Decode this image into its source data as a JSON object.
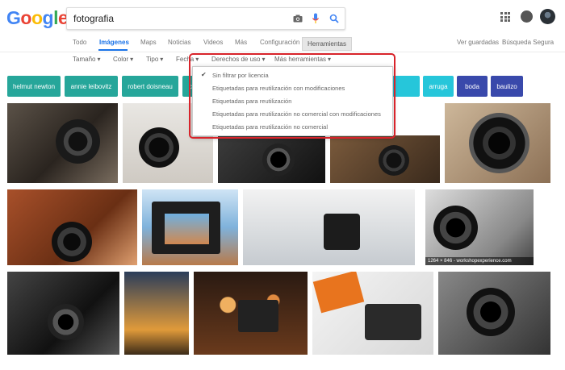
{
  "logo": {
    "letters": [
      "G",
      "o",
      "o",
      "g",
      "l",
      "e"
    ],
    "colors": [
      "#4285f4",
      "#ea4335",
      "#fbbc05",
      "#4285f4",
      "#34a853",
      "#ea4335"
    ]
  },
  "search": {
    "query": "fotografia"
  },
  "nav": {
    "tabs": [
      "Todo",
      "Imágenes",
      "Maps",
      "Noticias",
      "Videos",
      "Más",
      "Configuración",
      "Herramientas"
    ],
    "active": "Imágenes",
    "saved": "Ver guardadas",
    "safe_search": "Búsqueda Segura"
  },
  "tools": {
    "items": [
      "Tamaño",
      "Color",
      "Tipo",
      "Fecha",
      "Derechos de uso",
      "Más herramientas"
    ]
  },
  "chips": [
    {
      "label": "helmut newton",
      "color": "#26a69a"
    },
    {
      "label": "annie leibovitz",
      "color": "#26a69a"
    },
    {
      "label": "robert doisneau",
      "color": "#26a69a"
    },
    {
      "label": "ch",
      "color": "#26a69a"
    },
    {
      "label": "",
      "color": "#26c6da"
    },
    {
      "label": "arruga",
      "color": "#26c6da"
    },
    {
      "label": "boda",
      "color": "#3949ab"
    },
    {
      "label": "baulizo",
      "color": "#3949ab"
    }
  ],
  "usage_rights_menu": {
    "selected": "Sin filtrar por licencia",
    "options": [
      "Sin filtrar por licencia",
      "Etiquetadas para reutilización con modificaciones",
      "Etiquetadas para reutilización",
      "Etiquetadas para reutilización no comercial con modificaciones",
      "Etiquetadas para reutilización no comercial"
    ]
  },
  "image_caption": "1264 × 846 - workshopexperience.com",
  "icons": [
    "camera-icon",
    "mic-icon",
    "search-icon",
    "apps-grid-icon",
    "notifications-icon",
    "avatar"
  ]
}
